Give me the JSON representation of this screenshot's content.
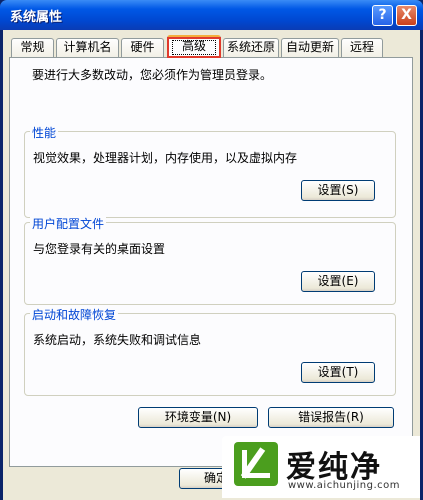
{
  "window": {
    "title": "系统属性",
    "help_glyph": "?",
    "close_glyph": "X"
  },
  "tabs": [
    {
      "label": "常规"
    },
    {
      "label": "计算机名"
    },
    {
      "label": "硬件"
    },
    {
      "label": "高级",
      "selected": true
    },
    {
      "label": "系统还原"
    },
    {
      "label": "自动更新"
    },
    {
      "label": "远程"
    }
  ],
  "panel": {
    "intro": "要进行大多数改动，您必须作为管理员登录。",
    "groups": [
      {
        "title": "性能",
        "description": "视觉效果，处理器计划，内存使用，以及虚拟内存",
        "button": "设置(S)"
      },
      {
        "title": "用户配置文件",
        "description": "与您登录有关的桌面设置",
        "button": "设置(E)"
      },
      {
        "title": "启动和故障恢复",
        "description": "系统启动，系统失败和调试信息",
        "button": "设置(T)"
      }
    ],
    "env_button": "环境变量(N)",
    "error_report_button": "错误报告(R)"
  },
  "footer": {
    "ok_button": "确定"
  },
  "watermark": {
    "name": "爱纯净",
    "url": "www.aichunjing.com"
  },
  "colors": {
    "selected_tab_highlight": "#e03a2c",
    "group_title": "#0046d5",
    "watermark_logo": "#4b9e1e"
  }
}
